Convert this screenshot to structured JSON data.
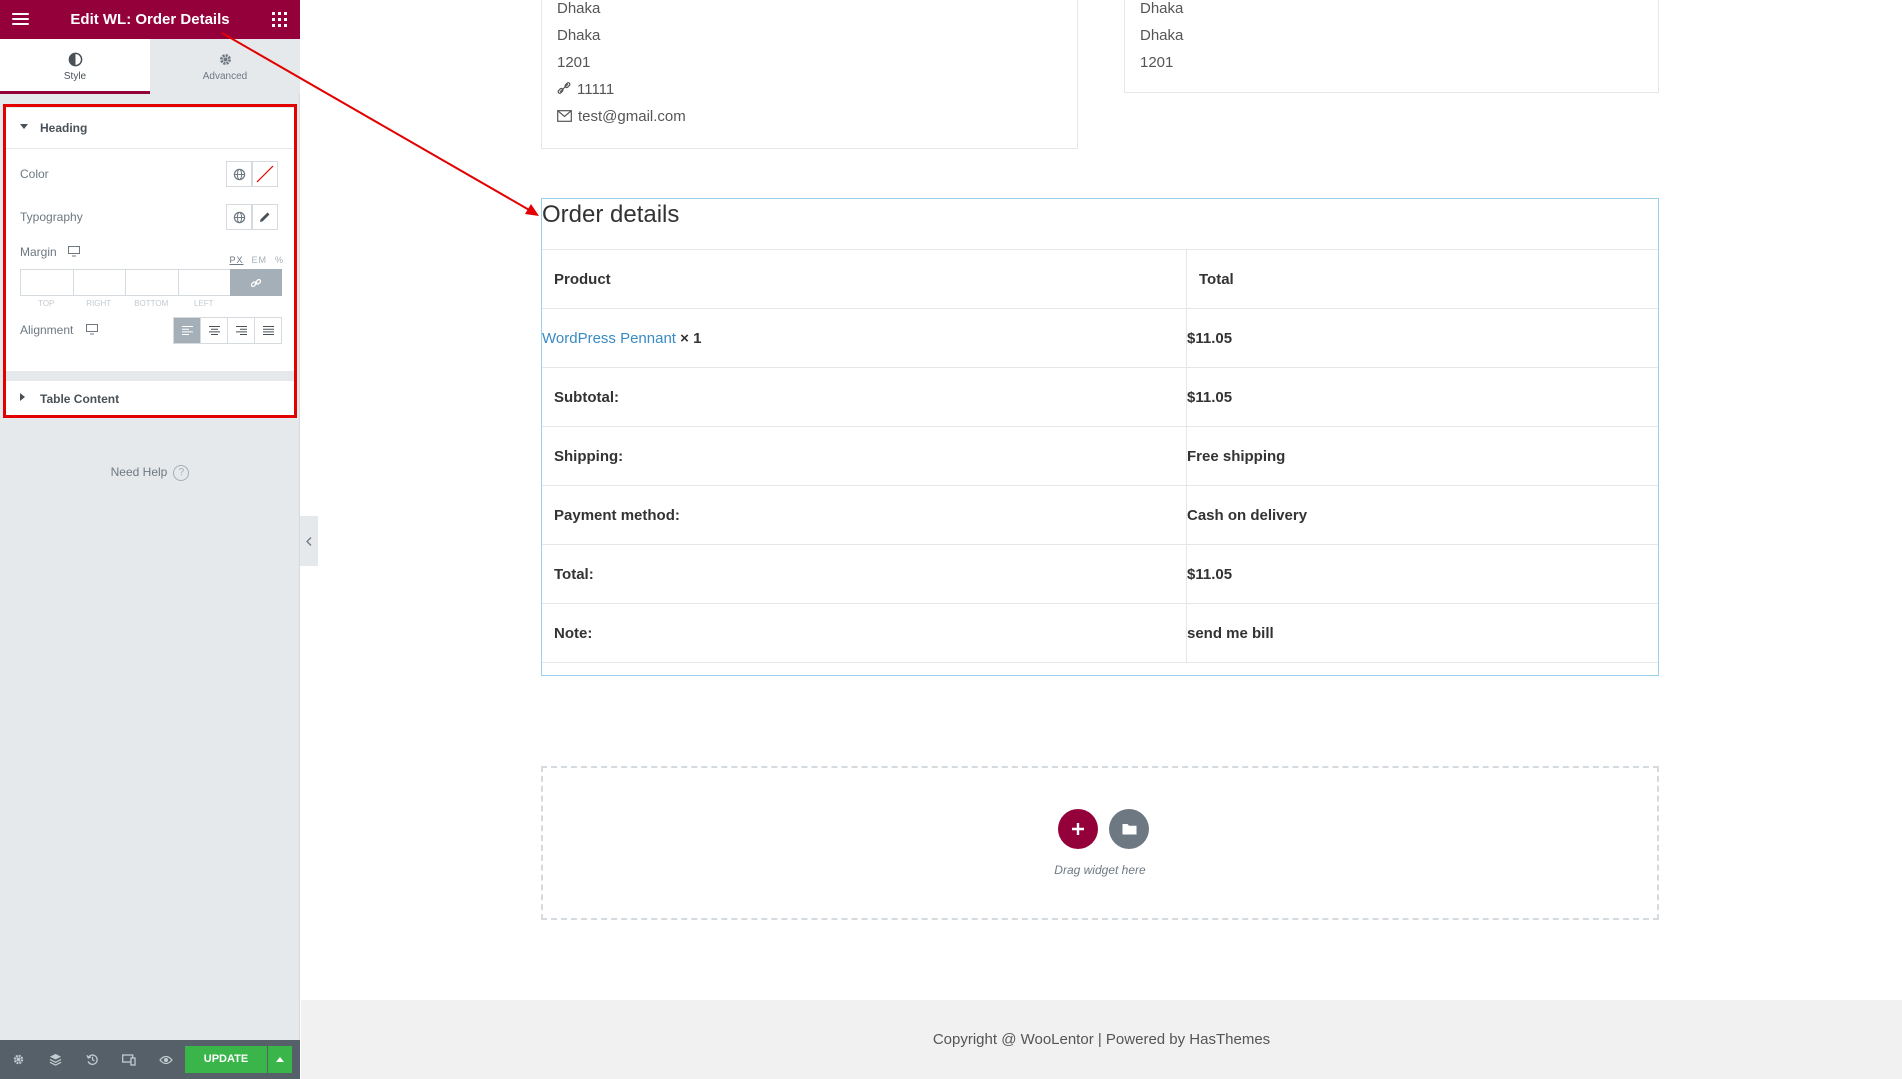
{
  "panel": {
    "header_title": "Edit WL: Order Details",
    "tabs": [
      {
        "label": "Style"
      },
      {
        "label": "Advanced"
      }
    ],
    "heading_section": {
      "title": "Heading",
      "color_label": "Color",
      "typography_label": "Typography",
      "margin_label": "Margin",
      "units": [
        "PX",
        "EM",
        "%"
      ],
      "dimension_labels": [
        "TOP",
        "RIGHT",
        "BOTTOM",
        "LEFT"
      ],
      "alignment_label": "Alignment"
    },
    "table_section": {
      "title": "Table Content"
    },
    "need_help": "Need Help",
    "update_label": "UPDATE"
  },
  "address_left": {
    "lines": [
      "Dhaka",
      "Dhaka",
      "1201",
      "11111",
      "test@gmail.com"
    ]
  },
  "address_right": {
    "lines": [
      "Dhaka",
      "Dhaka",
      "1201"
    ]
  },
  "order": {
    "title": "Order details",
    "headers": [
      "Product",
      "Total"
    ],
    "product": {
      "name": "WordPress Pennant",
      "qty": "× 1",
      "total": "$11.05"
    },
    "rows": [
      {
        "label": "Subtotal:",
        "value": "$11.05"
      },
      {
        "label": "Shipping:",
        "value": "Free shipping"
      },
      {
        "label": "Payment method:",
        "value": "Cash on delivery"
      },
      {
        "label": "Total:",
        "value": "$11.05"
      },
      {
        "label": "Note:",
        "value": "send me bill"
      }
    ]
  },
  "dropzone": {
    "text": "Drag widget here"
  },
  "footer": {
    "copyright": "Copyright @ WooLentor | Powered by HasThemes"
  },
  "colors": {
    "brand": "#93003a",
    "update": "#39b54a",
    "highlight": "#e20000",
    "link": "#3a8ac4"
  }
}
